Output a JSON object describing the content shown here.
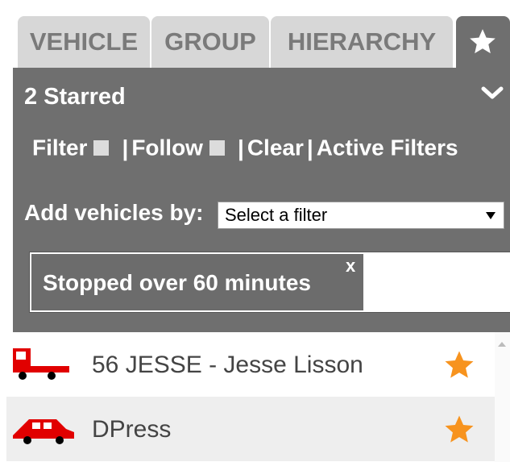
{
  "tabs": [
    {
      "label": "VEHICLE"
    },
    {
      "label": "GROUP"
    },
    {
      "label": "HIERARCHY"
    },
    {
      "label": "",
      "icon": "star-icon",
      "active": true
    }
  ],
  "header": {
    "starred_count": "2 Starred",
    "collapse_icon": "chevron-down-icon"
  },
  "filters": {
    "filter_label": "Filter",
    "follow_label": "Follow",
    "separator": "|",
    "clear_label": "Clear",
    "active_filters_label": "Active Filters"
  },
  "add_vehicles": {
    "label": "Add vehicles by:",
    "select_value": "Select a filter"
  },
  "active_filter_chip": {
    "label": "Stopped over 60 minutes",
    "remove": "x"
  },
  "vehicles": [
    {
      "name": "56 JESSE - Jesse Lisson",
      "icon": "tow-truck-icon",
      "starred": true
    },
    {
      "name": "DPress",
      "icon": "car-icon",
      "starred": true
    }
  ],
  "colors": {
    "panel_gray": "#6f6f6f",
    "tab_gray": "#d7d7d7",
    "vehicle_red": "#e10000",
    "star_orange": "#f7931e"
  }
}
